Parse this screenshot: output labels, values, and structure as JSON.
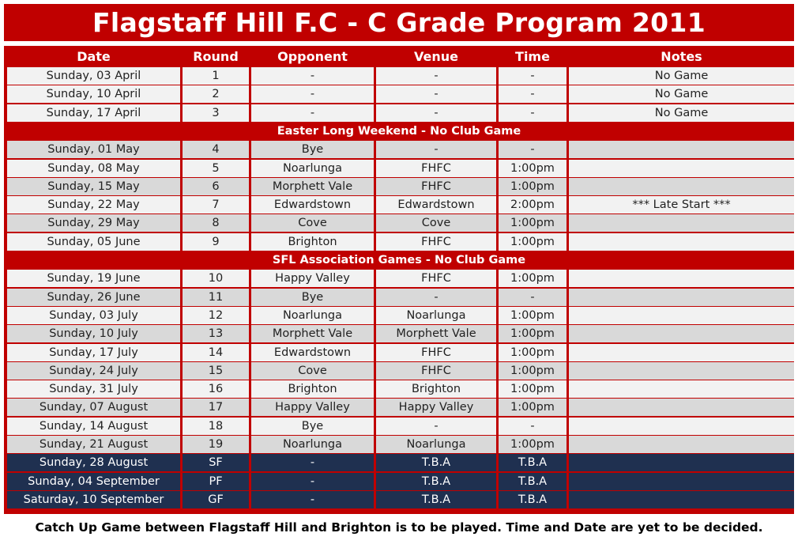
{
  "title": "Flagstaff Hill F.C - C Grade Program 2011",
  "headers": [
    "Date",
    "Round",
    "Opponent",
    "Venue",
    "Time",
    "Notes"
  ],
  "colors": {
    "brand_red": "#c00000",
    "light_row": "#f2f2f2",
    "dark_row": "#d9d9d9",
    "finals_navy": "#1f3050"
  },
  "rows": [
    {
      "kind": "light",
      "date": "Sunday, 03 April",
      "round": "1",
      "opponent": "-",
      "venue": "-",
      "time": "-",
      "notes": "No Game"
    },
    {
      "kind": "light",
      "date": "Sunday, 10 April",
      "round": "2",
      "opponent": "-",
      "venue": "-",
      "time": "-",
      "notes": "No Game"
    },
    {
      "kind": "light",
      "date": "Sunday, 17 April",
      "round": "3",
      "opponent": "-",
      "venue": "-",
      "time": "-",
      "notes": "No Game"
    },
    {
      "kind": "section",
      "text": "Easter Long Weekend - No Club Game"
    },
    {
      "kind": "dark",
      "date": "Sunday, 01 May",
      "round": "4",
      "opponent": "Bye",
      "venue": "-",
      "time": "-",
      "notes": ""
    },
    {
      "kind": "light",
      "date": "Sunday, 08 May",
      "round": "5",
      "opponent": "Noarlunga",
      "venue": "FHFC",
      "time": "1:00pm",
      "notes": ""
    },
    {
      "kind": "dark",
      "date": "Sunday, 15 May",
      "round": "6",
      "opponent": "Morphett Vale",
      "venue": "FHFC",
      "time": "1:00pm",
      "notes": ""
    },
    {
      "kind": "light",
      "date": "Sunday, 22 May",
      "round": "7",
      "opponent": "Edwardstown",
      "venue": "Edwardstown",
      "time": "2:00pm",
      "notes": "*** Late Start ***"
    },
    {
      "kind": "dark",
      "date": "Sunday, 29 May",
      "round": "8",
      "opponent": "Cove",
      "venue": "Cove",
      "time": "1:00pm",
      "notes": ""
    },
    {
      "kind": "light",
      "date": "Sunday, 05 June",
      "round": "9",
      "opponent": "Brighton",
      "venue": "FHFC",
      "time": "1:00pm",
      "notes": ""
    },
    {
      "kind": "section",
      "text": "SFL Association Games - No Club Game"
    },
    {
      "kind": "light",
      "date": "Sunday, 19 June",
      "round": "10",
      "opponent": "Happy Valley",
      "venue": "FHFC",
      "time": "1:00pm",
      "notes": ""
    },
    {
      "kind": "dark",
      "date": "Sunday, 26 June",
      "round": "11",
      "opponent": "Bye",
      "venue": "-",
      "time": "-",
      "notes": ""
    },
    {
      "kind": "light",
      "date": "Sunday, 03 July",
      "round": "12",
      "opponent": "Noarlunga",
      "venue": "Noarlunga",
      "time": "1:00pm",
      "notes": ""
    },
    {
      "kind": "dark",
      "date": "Sunday, 10 July",
      "round": "13",
      "opponent": "Morphett Vale",
      "venue": "Morphett Vale",
      "time": "1:00pm",
      "notes": ""
    },
    {
      "kind": "light",
      "date": "Sunday, 17 July",
      "round": "14",
      "opponent": "Edwardstown",
      "venue": "FHFC",
      "time": "1:00pm",
      "notes": ""
    },
    {
      "kind": "dark",
      "date": "Sunday, 24 July",
      "round": "15",
      "opponent": "Cove",
      "venue": "FHFC",
      "time": "1:00pm",
      "notes": ""
    },
    {
      "kind": "light",
      "date": "Sunday, 31 July",
      "round": "16",
      "opponent": "Brighton",
      "venue": "Brighton",
      "time": "1:00pm",
      "notes": ""
    },
    {
      "kind": "dark",
      "date": "Sunday, 07 August",
      "round": "17",
      "opponent": "Happy Valley",
      "venue": "Happy Valley",
      "time": "1:00pm",
      "notes": ""
    },
    {
      "kind": "light",
      "date": "Sunday, 14 August",
      "round": "18",
      "opponent": "Bye",
      "venue": "-",
      "time": "-",
      "notes": ""
    },
    {
      "kind": "dark",
      "date": "Sunday, 21 August",
      "round": "19",
      "opponent": "Noarlunga",
      "venue": "Noarlunga",
      "time": "1:00pm",
      "notes": ""
    },
    {
      "kind": "navy",
      "date": "Sunday, 28 August",
      "round": "SF",
      "opponent": "-",
      "venue": "T.B.A",
      "time": "T.B.A",
      "notes": ""
    },
    {
      "kind": "navy",
      "date": "Sunday, 04 September",
      "round": "PF",
      "opponent": "-",
      "venue": "T.B.A",
      "time": "T.B.A",
      "notes": ""
    },
    {
      "kind": "navy",
      "date": "Saturday, 10 September",
      "round": "GF",
      "opponent": "-",
      "venue": "T.B.A",
      "time": "T.B.A",
      "notes": ""
    }
  ],
  "footer": "Catch Up Game between Flagstaff Hill and Brighton is to be played. Time and Date are yet to be decided."
}
